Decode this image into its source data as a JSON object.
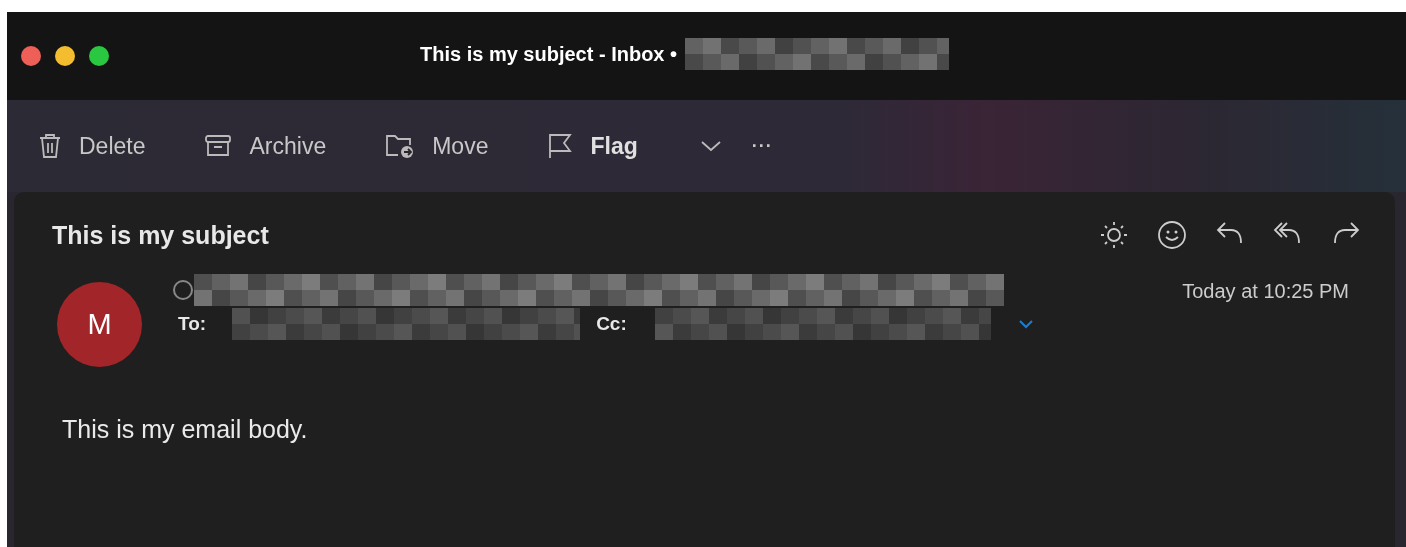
{
  "window": {
    "title": "This is my subject - Inbox •"
  },
  "toolbar": [
    {
      "kind": "delete",
      "label": "Delete",
      "emphasized": false
    },
    {
      "kind": "archive",
      "label": "Archive",
      "emphasized": false
    },
    {
      "kind": "move",
      "label": "Move",
      "emphasized": false
    },
    {
      "kind": "flag",
      "label": "Flag",
      "emphasized": true
    },
    {
      "kind": "dropdown"
    },
    {
      "kind": "more",
      "label": "···"
    }
  ],
  "message": {
    "subject": "This is my subject",
    "actions": [
      {
        "kind": "sun"
      },
      {
        "kind": "smiley"
      },
      {
        "kind": "reply"
      },
      {
        "kind": "reply-all"
      },
      {
        "kind": "forward"
      }
    ],
    "avatar": {
      "initial": "M",
      "color": "#a22629"
    },
    "to_label": "To:",
    "cc_label": "Cc:",
    "time": "Today at 10:25 PM",
    "body": "This is my email body."
  }
}
